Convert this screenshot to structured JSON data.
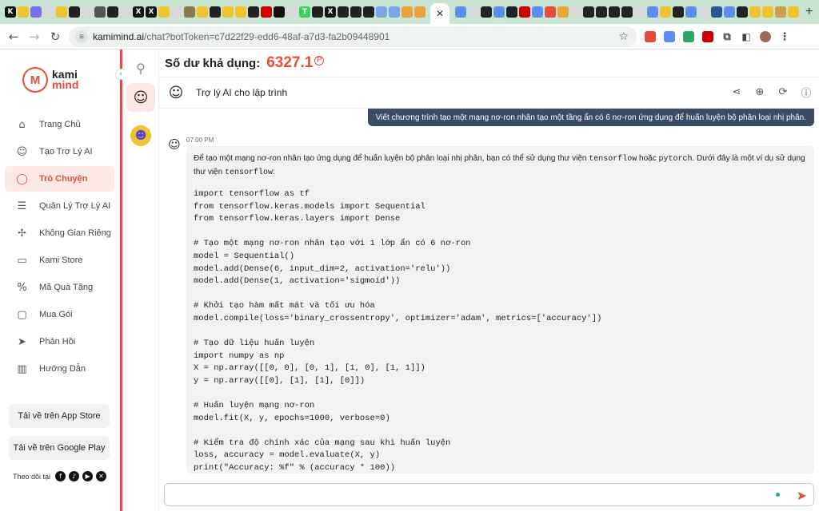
{
  "browser": {
    "url_host": "kamimind.ai",
    "url_path": "/chat?botToken=c7d22f29-edd6-48af-a7d3-fa2b09448901",
    "tab_close": "✕",
    "new_tab": "+"
  },
  "sidebar": {
    "logo_top": "kami",
    "logo_bottom": "mind",
    "items": [
      {
        "label": "Trang Chủ",
        "icon": "home-icon",
        "glyph": "⌂"
      },
      {
        "label": "Tạo Trợ Lý AI",
        "icon": "bot-create-icon",
        "glyph": "☺"
      },
      {
        "label": "Trò Chuyện",
        "icon": "chat-icon",
        "glyph": "◯"
      },
      {
        "label": "Quản Lý Trợ Lý AI",
        "icon": "list-icon",
        "glyph": "☰"
      },
      {
        "label": "Không Gian Riêng",
        "icon": "puzzle-icon",
        "glyph": "✢"
      },
      {
        "label": "Kami Store",
        "icon": "store-icon",
        "glyph": "▭"
      },
      {
        "label": "Mã Quà Tặng",
        "icon": "coupon-icon",
        "glyph": "%"
      },
      {
        "label": "Mua Gói",
        "icon": "wallet-icon",
        "glyph": "▢"
      },
      {
        "label": "Phản Hồi",
        "icon": "send-feedback-icon",
        "glyph": "➤"
      },
      {
        "label": "Hướng Dẫn",
        "icon": "book-icon",
        "glyph": "▥"
      }
    ],
    "app_store": "Tải về trên App Store",
    "google_play": "Tải về trên Google Play",
    "follow_label": "Theo dõi tại"
  },
  "header": {
    "balance_label": "Số dư khả dụng:",
    "balance_value": "6327.1",
    "coin_symbol": "P"
  },
  "chat": {
    "bot_name": "Trợ lý AI cho lập trình",
    "user_message": "Viết chương trình tạo một mạng nơ-ron nhân tạo một tầng ẩn có 6 nơ-ron ứng dụng để huấn luyện bộ phân loại nhị phân.",
    "reply_time": "07:00 PM",
    "reply_intro_1": "Để tạo một mạng nơ-ron nhân tạo ứng dụng để huấn luyện bộ phân loại nhị phân, bạn có thể sử dụng thư viện ",
    "reply_lib_1": "tensorflow",
    "reply_intro_2": " hoặc ",
    "reply_lib_2": "pytorch",
    "reply_intro_3": ". Dưới đây là một ví dụ sử dụng thư viện ",
    "reply_lib_3": "tensorflow",
    "reply_intro_4": ":",
    "code": "import tensorflow as tf\nfrom tensorflow.keras.models import Sequential\nfrom tensorflow.keras.layers import Dense\n\n# Tạo một mạng nơ-ron nhân tạo với 1 lớp ẩn có 6 nơ-ron\nmodel = Sequential()\nmodel.add(Dense(6, input_dim=2, activation='relu'))\nmodel.add(Dense(1, activation='sigmoid'))\n\n# Khởi tạo hàm mất mát và tối ưu hóa\nmodel.compile(loss='binary_crossentropy', optimizer='adam', metrics=['accuracy'])\n\n# Tạo dữ liệu huấn luyện\nimport numpy as np\nX = np.array([[0, 0], [0, 1], [1, 0], [1, 1]])\ny = np.array([[0], [1], [1], [0]])\n\n# Huấn luyện mạng nơ-ron\nmodel.fit(X, y, epochs=1000, verbose=0)\n\n# Kiểm tra độ chính xác của mạng sau khi huấn luyện\nloss, accuracy = model.evaluate(X, y)\nprint(\"Accuracy: %f\" % (accuracy * 100))",
    "input_placeholder": ""
  },
  "colors": {
    "accent": "#e84c3d",
    "user_bubble": "#3b4a66",
    "tabstrip": "#c9e5d1"
  }
}
